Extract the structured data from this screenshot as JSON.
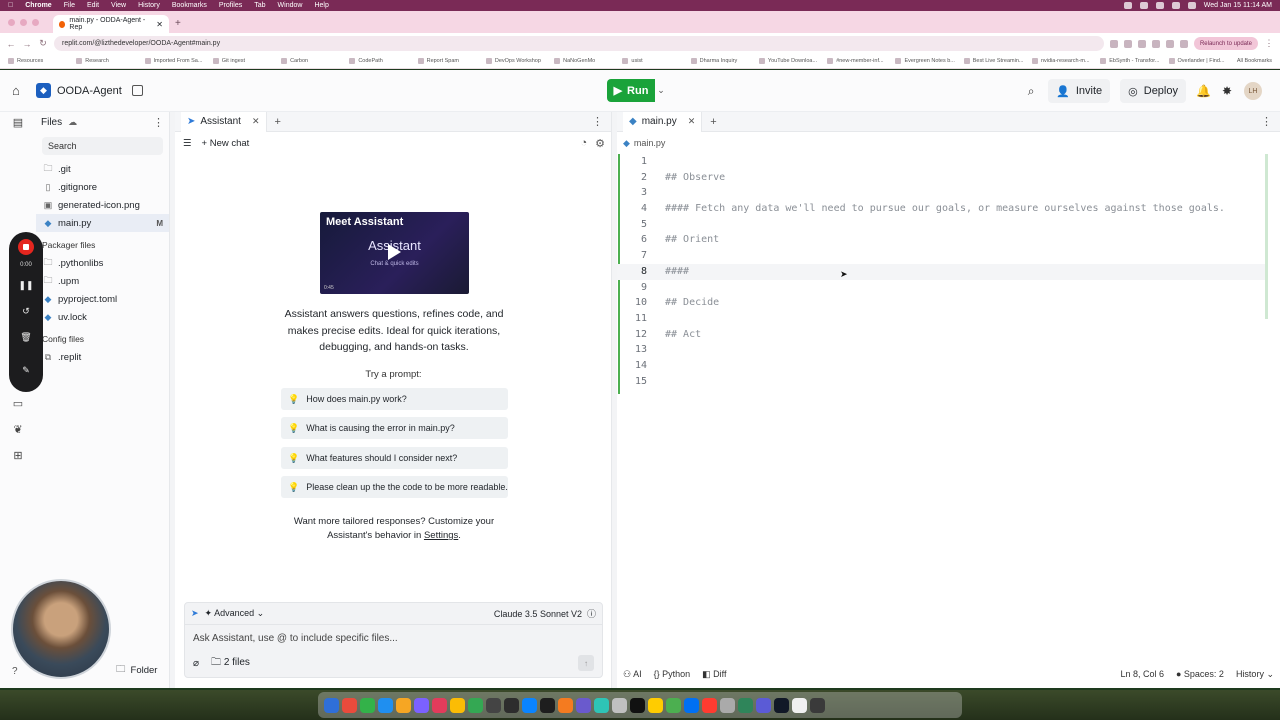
{
  "macbar": {
    "apple": "",
    "menus": [
      "Chrome",
      "File",
      "Edit",
      "View",
      "History",
      "Bookmarks",
      "Profiles",
      "Tab",
      "Window",
      "Help"
    ],
    "clock": "Wed Jan 15  11:14 AM"
  },
  "browser": {
    "tab_title": "main.py - ODDA-Agent - Rep",
    "url": "replit.com/@lizthedeveloper/OODA-Agent#main.py",
    "relaunch": "Relaunch to update",
    "bookmarks": [
      "Resources",
      "Research",
      "Imported From Sa...",
      "Git ingest",
      "Carbon",
      "CodePath",
      "Report Spam",
      "DevOps Workshop",
      "NaNoGenMo",
      "usist",
      "Dharma Inquiry",
      "YouTube Downloa...",
      "#new-member-inf...",
      "Evergreen Notes b...",
      "Best Live Streamin...",
      "nvidia-research-m...",
      "EbSynth - Transfor...",
      "Overlander | Find..."
    ],
    "all_bookmarks": "All Bookmarks"
  },
  "header": {
    "project": "OODA-Agent",
    "run": "Run",
    "invite": "Invite",
    "deploy": "Deploy",
    "avatar": "LH"
  },
  "recorder": {
    "time": "0:00"
  },
  "files": {
    "title": "Files",
    "search_placeholder": "Search",
    "items": [
      {
        "name": ".git",
        "icon": "folder-icon"
      },
      {
        "name": ".gitignore",
        "icon": "file-icon"
      },
      {
        "name": "generated-icon.png",
        "icon": "image-icon"
      },
      {
        "name": "main.py",
        "icon": "python-icon",
        "badge": "M"
      }
    ],
    "packager_title": "Packager files",
    "packager_items": [
      {
        "name": ".pythonlibs",
        "icon": "folder-icon"
      },
      {
        "name": ".upm",
        "icon": "folder-icon"
      },
      {
        "name": "pyproject.toml",
        "icon": "python-icon"
      },
      {
        "name": "uv.lock",
        "icon": "python-icon"
      }
    ],
    "config_title": "Config files",
    "config_items": [
      {
        "name": ".replit",
        "icon": "replit-icon"
      }
    ],
    "folder_btn": "Folder"
  },
  "assistant": {
    "tab": "Assistant",
    "new_chat": "New chat",
    "video_title": "Meet Assistant",
    "video_brand": "Assistant",
    "video_sub": "Chat & quick edits",
    "video_time": "0:45",
    "description": "Assistant answers questions, refines code, and makes precise edits. Ideal for quick iterations, debugging, and hands-on tasks.",
    "try_prompt": "Try a prompt:",
    "prompts": [
      "How does main.py work?",
      "What is causing the error in main.py?",
      "What features should I consider next?",
      "Please clean up the the code to be more readable."
    ],
    "tailored_prefix": "Want more tailored responses? Customize your Assistant's behavior in ",
    "tailored_link": "Settings",
    "tailored_suffix": ".",
    "mode": "Advanced",
    "model": "Claude 3.5 Sonnet V2",
    "input_placeholder": "Ask Assistant, use @ to include specific files...",
    "files_count": "2 files"
  },
  "editor": {
    "tab": "main.py",
    "breadcrumb": "main.py",
    "lines": [
      {
        "n": "1",
        "text": ""
      },
      {
        "n": "2",
        "text": "## Observe"
      },
      {
        "n": "3",
        "text": ""
      },
      {
        "n": "4",
        "text": "#### Fetch any data we'll need to pursue our goals, or measure ourselves against those goals."
      },
      {
        "n": "5",
        "text": ""
      },
      {
        "n": "6",
        "text": "## Orient"
      },
      {
        "n": "7",
        "text": ""
      },
      {
        "n": "8",
        "text": "####"
      },
      {
        "n": "9",
        "text": ""
      },
      {
        "n": "10",
        "text": "## Decide"
      },
      {
        "n": "11",
        "text": ""
      },
      {
        "n": "12",
        "text": "## Act"
      },
      {
        "n": "13",
        "text": ""
      },
      {
        "n": "14",
        "text": ""
      },
      {
        "n": "15",
        "text": ""
      }
    ],
    "status": {
      "ai": "AI",
      "lang": "Python",
      "diff": "Diff",
      "position": "Ln 8, Col 6",
      "spaces": "Spaces: 2",
      "history": "History"
    }
  }
}
